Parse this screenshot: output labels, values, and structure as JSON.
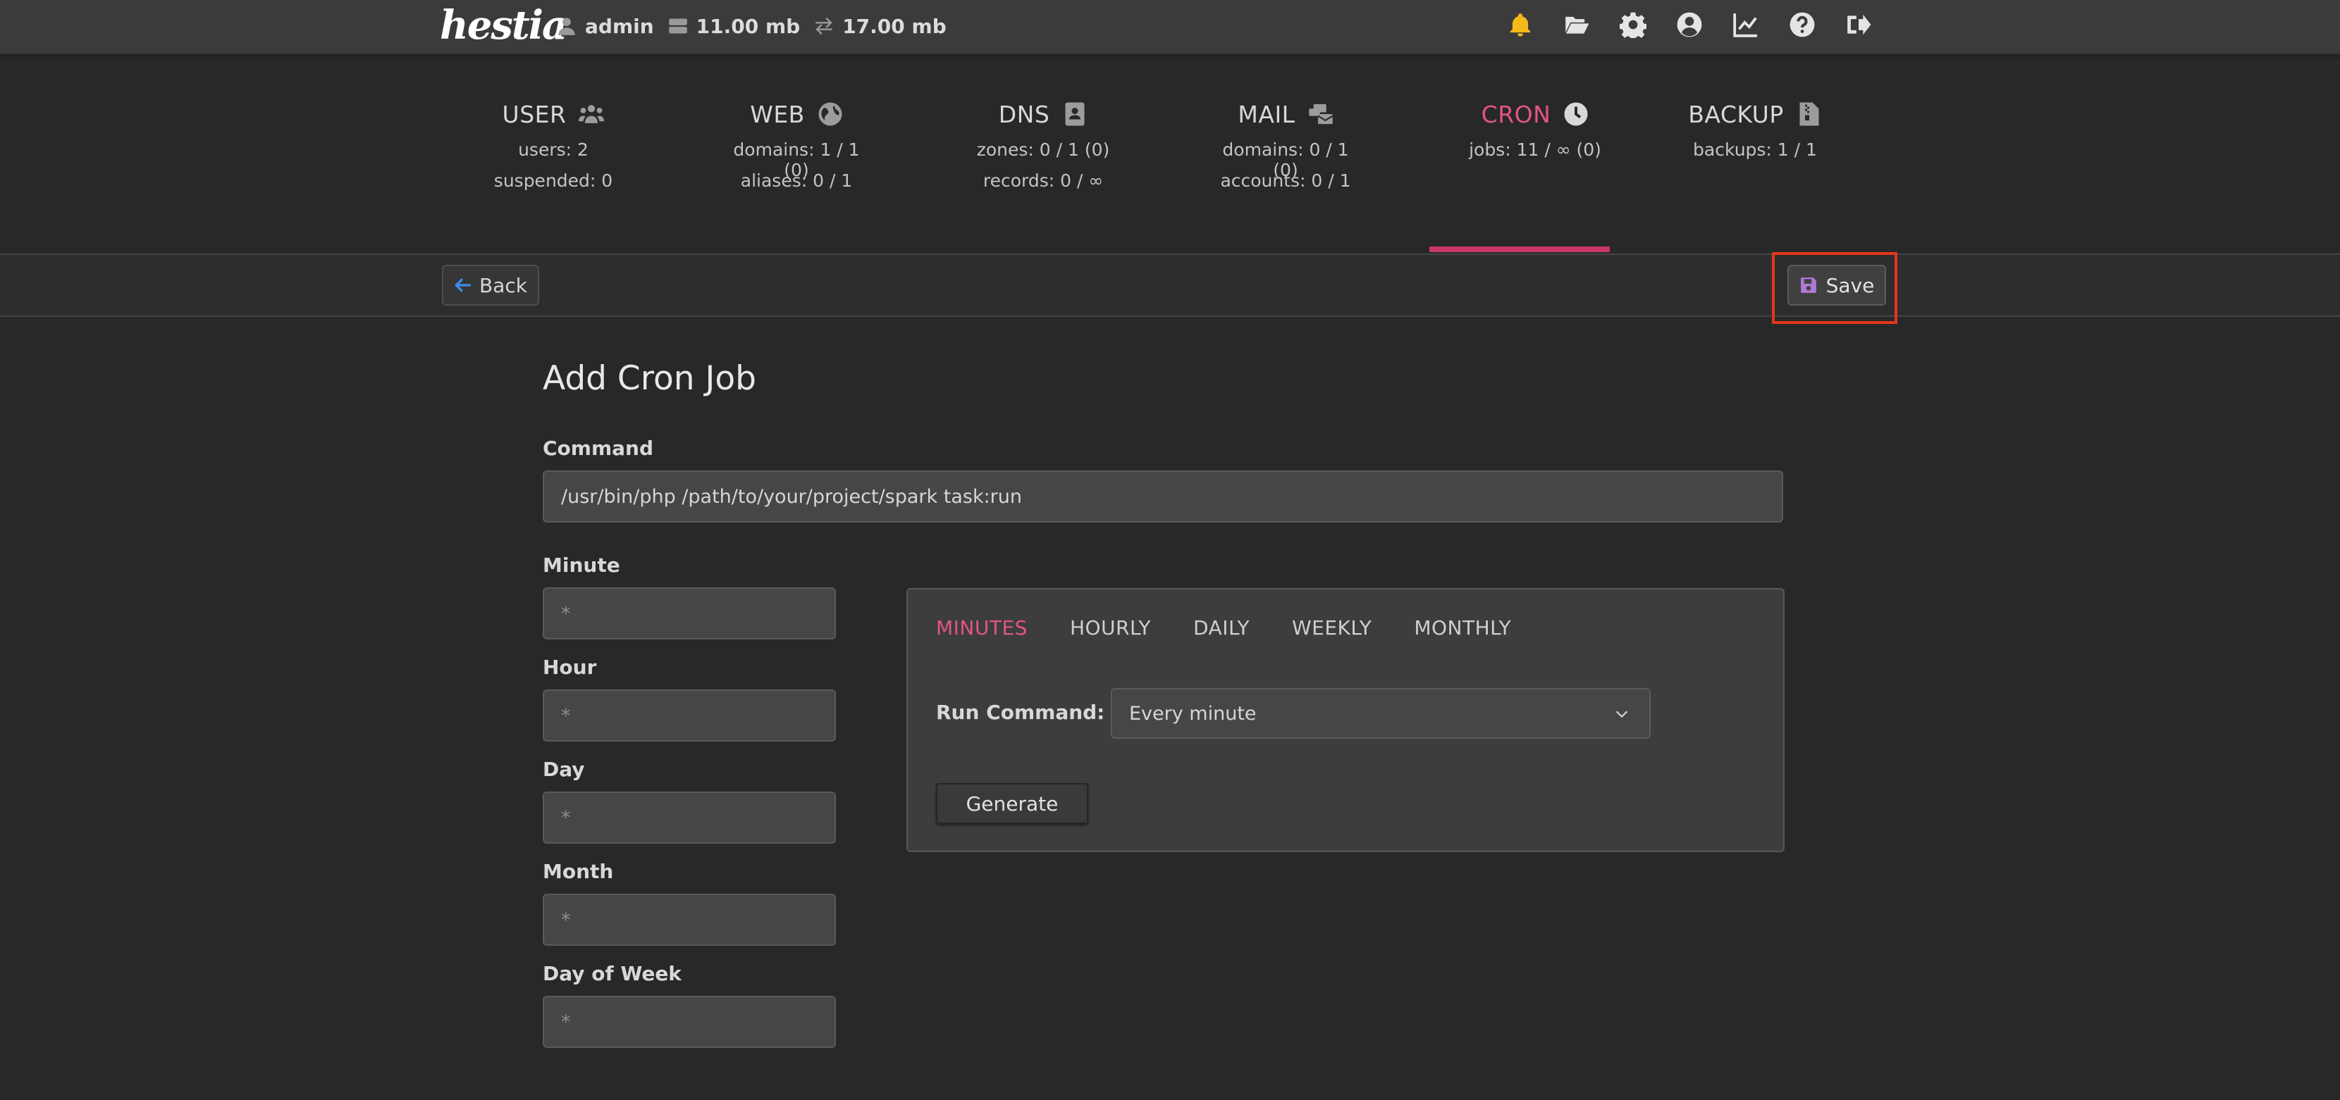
{
  "app": {
    "logo_text": "hestia"
  },
  "topbar": {
    "user": "admin",
    "disk": "11.00 mb",
    "bandwidth": "17.00 mb",
    "icons": [
      "bell-icon",
      "folder-open-icon",
      "gear-icon",
      "user-circle-icon",
      "chart-line-icon",
      "question-circle-icon",
      "sign-out-icon"
    ]
  },
  "summary": [
    {
      "title": "USER",
      "icon": "users-icon",
      "lines": [
        "users: 2",
        "suspended: 0"
      ]
    },
    {
      "title": "WEB",
      "icon": "globe-icon",
      "lines": [
        "domains: 1 / 1 (0)",
        "aliases: 0 / 1"
      ]
    },
    {
      "title": "DNS",
      "icon": "address-book-icon",
      "lines": [
        "zones: 0 / 1 (0)",
        "records: 0 / ∞"
      ]
    },
    {
      "title": "MAIL",
      "icon": "mail-bulk-icon",
      "lines": [
        "domains: 0 / 1 (0)",
        "accounts: 0 / 1"
      ]
    },
    {
      "title": "CRON",
      "icon": "clock-icon",
      "lines": [
        "jobs: 11 / ∞ (0)"
      ],
      "active": true
    },
    {
      "title": "BACKUP",
      "icon": "file-archive-icon",
      "lines": [
        "backups: 1 / 1"
      ]
    }
  ],
  "toolbar": {
    "back_label": "Back",
    "save_label": "Save"
  },
  "form": {
    "title": "Add Cron Job",
    "command_label": "Command",
    "command_value": "/usr/bin/php /path/to/your/project/spark task:run",
    "fields": [
      {
        "label": "Minute",
        "placeholder": "*"
      },
      {
        "label": "Hour",
        "placeholder": "*"
      },
      {
        "label": "Day",
        "placeholder": "*"
      },
      {
        "label": "Month",
        "placeholder": "*"
      },
      {
        "label": "Day of Week",
        "placeholder": "*"
      }
    ]
  },
  "generator": {
    "tabs": [
      "MINUTES",
      "HOURLY",
      "DAILY",
      "WEEKLY",
      "MONTHLY"
    ],
    "active_tab": "MINUTES",
    "run_label": "Run Command:",
    "run_value": "Every minute",
    "generate_label": "Generate"
  },
  "colors": {
    "accent": "#e25582",
    "highlight": "#e2371a",
    "save_icon": "#b07ad8",
    "back_icon": "#3d8ee8",
    "bell": "#f5b91c"
  }
}
